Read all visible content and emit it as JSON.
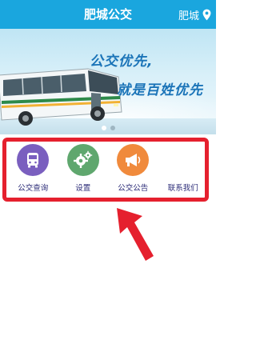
{
  "header": {
    "title": "肥城公交",
    "city": "肥城"
  },
  "banner": {
    "slogan_line1": "公交优先,",
    "slogan_line2": "就是百姓优先",
    "active_slide": 1,
    "slide_count": 2
  },
  "menu": {
    "items": [
      {
        "label": "公交查询",
        "icon": "bus-icon",
        "color": "#7a5fbf"
      },
      {
        "label": "设置",
        "icon": "gear-icon",
        "color": "#5fa76e"
      },
      {
        "label": "公交公告",
        "icon": "megaphone-icon",
        "color": "#f08a3c"
      },
      {
        "label": "联系我们",
        "icon": "",
        "color": ""
      }
    ]
  },
  "colors": {
    "title_bar": "#1aa6de",
    "highlight": "#e5202e",
    "label_text": "#2f2f7a"
  }
}
